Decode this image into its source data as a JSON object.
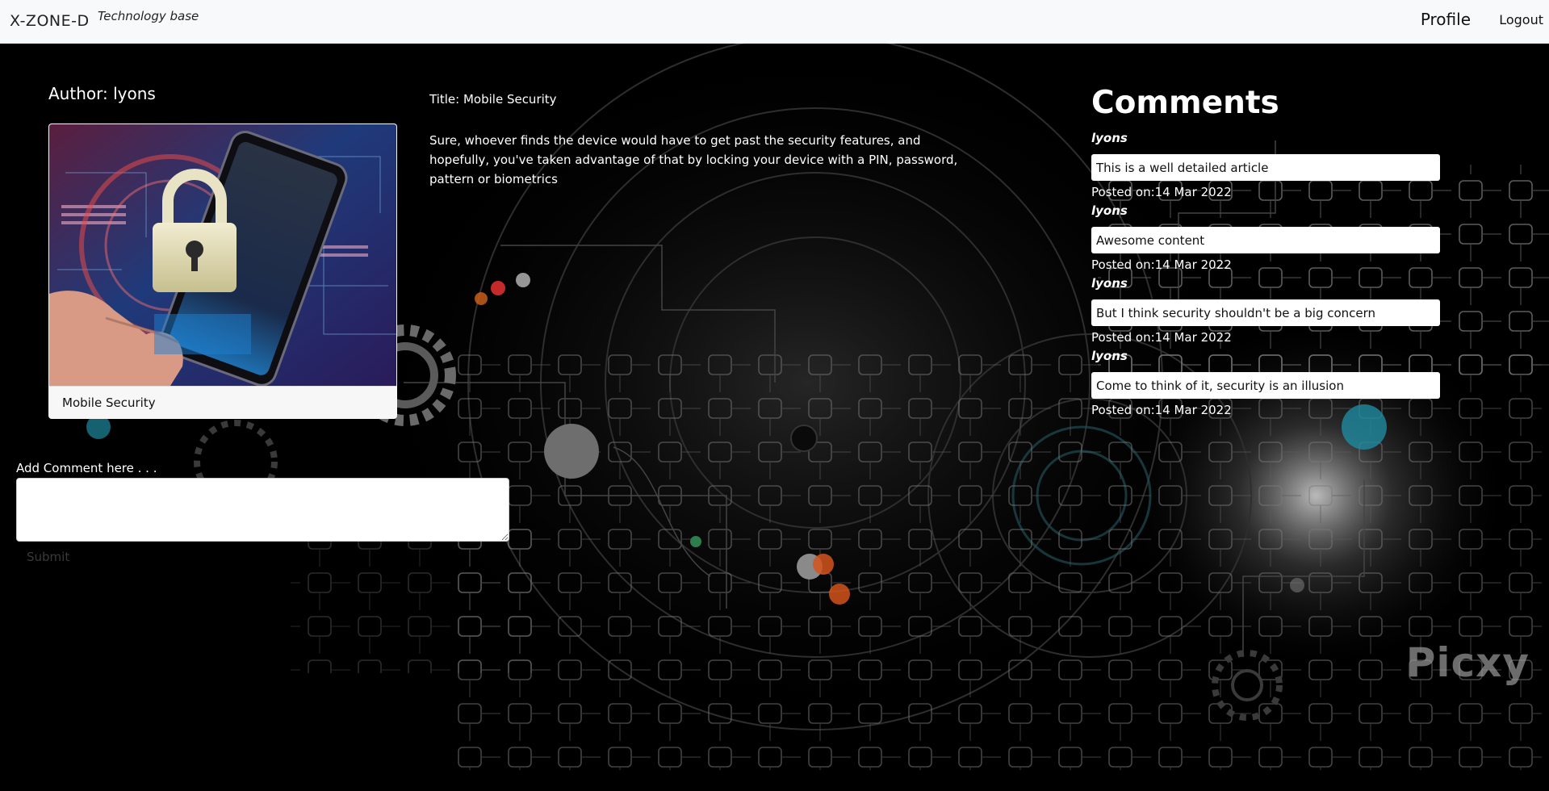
{
  "navbar": {
    "brand": "X-ZONE-D",
    "tagline": "Technology base",
    "profile_label": "Profile",
    "logout_label": "Logout"
  },
  "post": {
    "author_label": "Author: lyons",
    "image_caption": "Mobile Security",
    "title": "Title: Mobile Security",
    "body": "Sure, whoever finds the device would have to get past the security features, and hopefully, you've taken advantage of that by locking your device with a PIN, password, pattern or biometrics"
  },
  "comments": {
    "heading": "Comments",
    "items": [
      {
        "author": "lyons",
        "text": "This is a well detailed article",
        "posted": "Posted on:14 Mar 2022"
      },
      {
        "author": "lyons",
        "text": "Awesome content",
        "posted": "Posted on:14 Mar 2022"
      },
      {
        "author": "lyons",
        "text": "But I think security shouldn't be a big concern",
        "posted": "Posted on:14 Mar 2022"
      },
      {
        "author": "lyons",
        "text": "Come to think of it, security is an illusion",
        "posted": "Posted on:14 Mar 2022"
      }
    ]
  },
  "add_comment": {
    "label": "Add Comment here . . .",
    "value": "",
    "submit_label": "Submit"
  },
  "background": {
    "watermark": "Picxy"
  },
  "colors": {
    "navbar_bg": "#f8f9fa",
    "page_bg": "#000000",
    "accent_teal": "#1f8aa0",
    "accent_orange": "#d4541c"
  }
}
